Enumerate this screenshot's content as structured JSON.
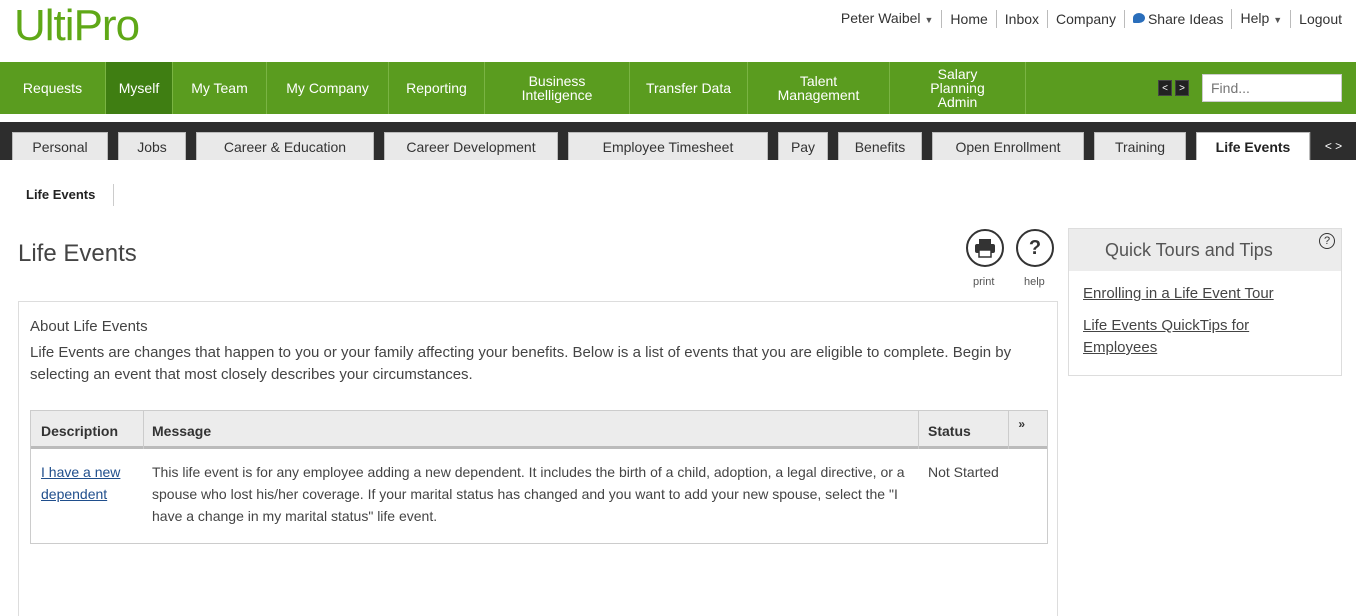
{
  "logo": {
    "text_a": "Ult",
    "text_b": "Pro"
  },
  "toplinks": {
    "user": "Peter Waibel",
    "home": "Home",
    "inbox": "Inbox",
    "company": "Company",
    "share_ideas": "Share Ideas",
    "help": "Help",
    "logout": "Logout"
  },
  "greennav": {
    "items": [
      {
        "label": "Requests"
      },
      {
        "label": "Myself"
      },
      {
        "label": "My Team"
      },
      {
        "label": "My Company"
      },
      {
        "label": "Reporting"
      },
      {
        "line1": "Business",
        "line2": "Intelligence"
      },
      {
        "label": "Transfer Data"
      },
      {
        "line1": "Talent",
        "line2": "Management"
      },
      {
        "line1": "Salary",
        "line2": "Planning",
        "line3": "Admin"
      }
    ],
    "find_placeholder": "Find..."
  },
  "tabs": [
    "Personal",
    "Jobs",
    "Career & Education",
    "Career Development",
    "Employee Timesheet",
    "Pay",
    "Benefits",
    "Open Enrollment",
    "Training",
    "Life Events"
  ],
  "subtab": "Life Events",
  "page": {
    "title": "Life Events",
    "print_label": "print",
    "help_label": "help"
  },
  "about": {
    "title": "About Life Events",
    "text": "Life Events are changes that happen to you or your family affecting your benefits. Below is a list of events that you are eligible to complete. Begin by selecting an event that most closely describes your circumstances."
  },
  "grid": {
    "headers": {
      "description": "Description",
      "message": "Message",
      "status": "Status"
    },
    "rows": [
      {
        "description": "I have a new dependent",
        "message": "This life event is for any employee adding a new dependent. It includes the birth of a child, adoption, a legal directive, or a spouse who lost his/her coverage. If your marital status has changed and you want to add your new spouse, select the \"I have a change in my marital status\" life event.",
        "status": "Not Started"
      }
    ]
  },
  "quicktours": {
    "title": "Quick Tours and Tips",
    "links": [
      "Enrolling in a Life Event Tour",
      "Life Events QuickTips for Employees"
    ]
  },
  "colors": {
    "brand_green": "#5a9c1f",
    "active_green": "#3f7e12",
    "link_blue": "#1f4e8c"
  }
}
